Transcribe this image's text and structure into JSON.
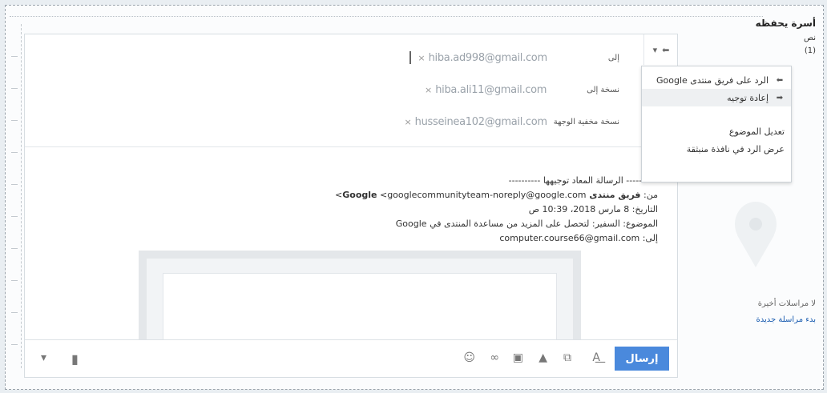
{
  "header": {
    "to_label": "إلى",
    "cc_label": "نسخة إلى",
    "bcc_label": "نسخة مخفية الوجهة",
    "to_email": "hiba.ad998@gmail.com",
    "cc_email": "hiba.ali11@gmail.com",
    "bcc_email": "husseinea102@gmail.com"
  },
  "reply_menu": {
    "items": [
      {
        "label": "الرد على فريق منتدى Google",
        "icon": "reply-icon"
      },
      {
        "label": "إعادة توجيه",
        "icon": "forward-icon"
      },
      {
        "label": "تعديل الموضوع"
      },
      {
        "label": "عرض الرد في نافذة منبثقة"
      }
    ]
  },
  "forwarded": {
    "header": "---------- الرسالة المعاد توجيهها ----------",
    "from_label": "من:",
    "from_name": "فريق منتدى Google",
    "from_email": "<googlecommunityteam-noreply@google.com>",
    "date_line": "التاريخ: 8 مارس 2018، 10:39 ص",
    "subject_line": "الموضوع: السفير: لتحصل على المزيد من مساعدة المنتدى في Google",
    "to_line": "إلى: computer.course66@gmail.com"
  },
  "toolbar": {
    "send_label": "إرسال"
  },
  "sidebar": {
    "name": "أسرة يحفظه",
    "line1": "نص",
    "line2": "(1)",
    "no_recent": "لا مراسلات أخيرة",
    "new_msg": "بدء مراسلة جديدة"
  },
  "colors": {
    "accent": "#4a89dc"
  }
}
